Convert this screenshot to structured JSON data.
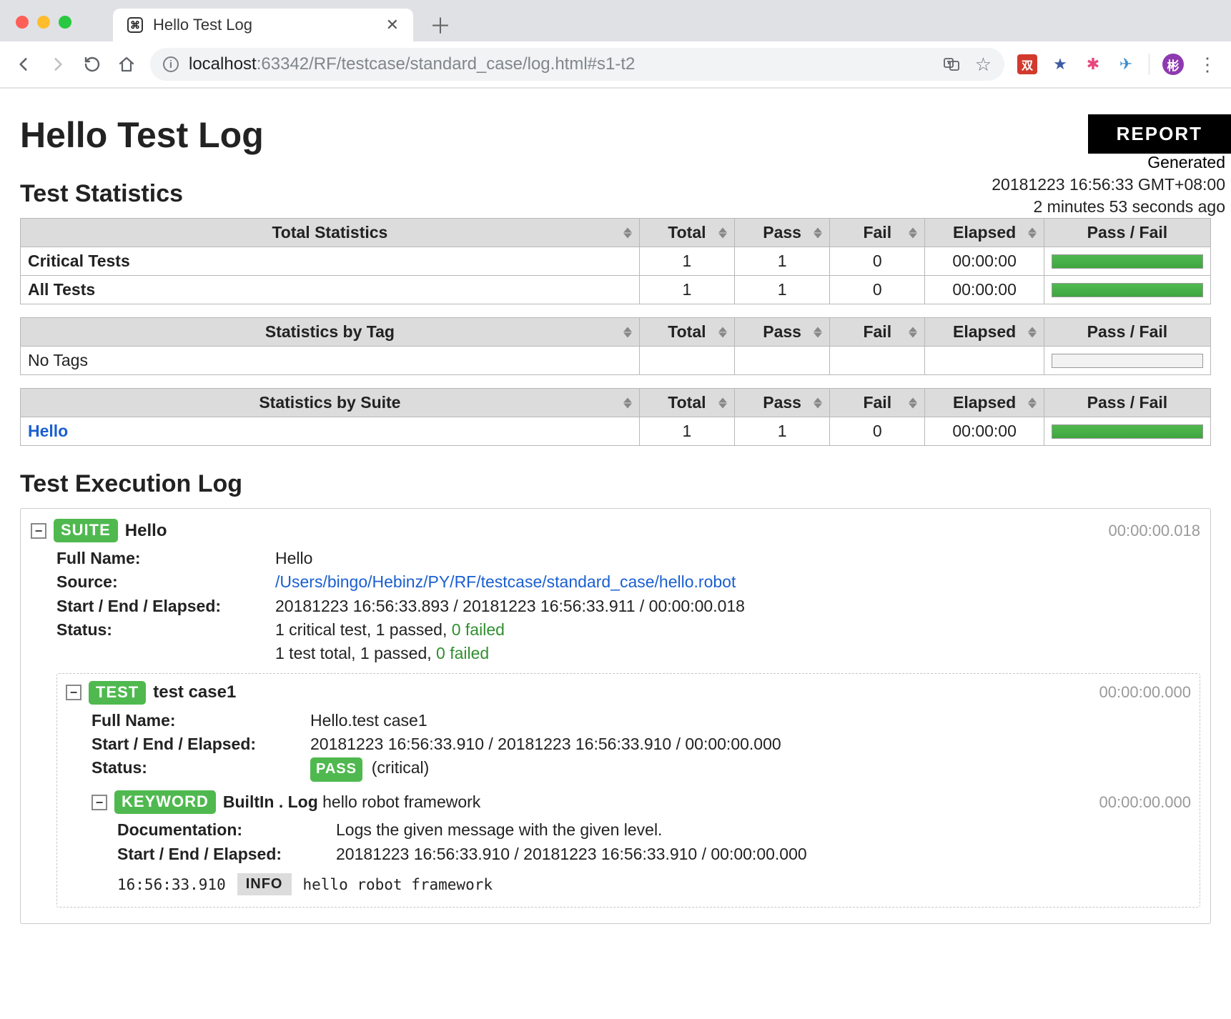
{
  "browser": {
    "tab_title": "Hello Test Log",
    "url_host": "localhost",
    "url_port": ":63342",
    "url_path": "/RF/testcase/standard_case/log.html#s1-t2"
  },
  "report_button": "REPORT",
  "generated": {
    "label": "Generated",
    "timestamp": "20181223 16:56:33 GMT+08:00",
    "ago": "2 minutes 53 seconds ago"
  },
  "page_title": "Hello Test Log",
  "sections": {
    "stats": "Test Statistics",
    "exec": "Test Execution Log"
  },
  "stat_headers": {
    "total_stats": "Total Statistics",
    "by_tag": "Statistics by Tag",
    "by_suite": "Statistics by Suite",
    "total": "Total",
    "pass": "Pass",
    "fail": "Fail",
    "elapsed": "Elapsed",
    "passfail": "Pass / Fail"
  },
  "total_stats": [
    {
      "name": "Critical Tests",
      "total": "1",
      "pass": "1",
      "fail": "0",
      "elapsed": "00:00:00"
    },
    {
      "name": "All Tests",
      "total": "1",
      "pass": "1",
      "fail": "0",
      "elapsed": "00:00:00"
    }
  ],
  "tag_stats_empty": "No Tags",
  "suite_stats": [
    {
      "name": "Hello",
      "total": "1",
      "pass": "1",
      "fail": "0",
      "elapsed": "00:00:00"
    }
  ],
  "suite": {
    "badge": "SUITE",
    "name": "Hello",
    "elapsed": "00:00:00.018",
    "full_name_label": "Full Name:",
    "full_name": "Hello",
    "source_label": "Source:",
    "source": "/Users/bingo/Hebinz/PY/RF/testcase/standard_case/hello.robot",
    "see_label": "Start / End / Elapsed:",
    "see_value": "20181223 16:56:33.893 / 20181223 16:56:33.911 / 00:00:00.018",
    "status_label": "Status:",
    "status_line1a": "1 critical test, 1 passed, ",
    "status_line1b": "0 failed",
    "status_line2a": "1 test total, 1 passed, ",
    "status_line2b": "0 failed"
  },
  "test": {
    "badge": "TEST",
    "name": "test case1",
    "elapsed": "00:00:00.000",
    "full_name_label": "Full Name:",
    "full_name": "Hello.test case1",
    "see_label": "Start / End / Elapsed:",
    "see_value": "20181223 16:56:33.910 / 20181223 16:56:33.910 / 00:00:00.000",
    "status_label": "Status:",
    "status_badge": "PASS",
    "status_extra": "(critical)"
  },
  "keyword": {
    "badge": "KEYWORD",
    "lib": "BuiltIn . Log",
    "args": "hello robot framework",
    "elapsed": "00:00:00.000",
    "doc_label": "Documentation:",
    "doc": "Logs the given message with the given level.",
    "see_label": "Start / End / Elapsed:",
    "see_value": "20181223 16:56:33.910 / 20181223 16:56:33.910 / 00:00:00.000",
    "msg_time": "16:56:33.910",
    "msg_level": "INFO",
    "msg_text": "hello robot framework"
  }
}
